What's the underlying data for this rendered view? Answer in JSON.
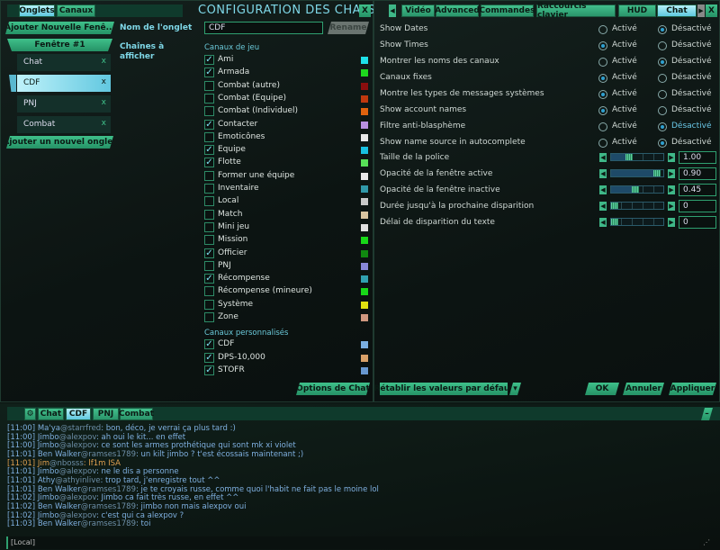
{
  "left": {
    "tabs": [
      "Onglets",
      "Canaux"
    ],
    "title": "CONFIGURATION DES CHATS",
    "close": "X",
    "add_window": "Ajouter Nouvelle Fenê...",
    "window_label": "Fenêtre #1",
    "chat_tabs": [
      {
        "label": "Chat",
        "selected": false
      },
      {
        "label": "CDF",
        "selected": true
      },
      {
        "label": "PNJ",
        "selected": false
      },
      {
        "label": "Combat",
        "selected": false
      }
    ],
    "remove_glyph": "x",
    "add_tab": "Ajouter un nouvel onglet",
    "tab_name_label": "Nom de l'onglet",
    "tab_name_value": "CDF",
    "rename": "Rename",
    "channels_label": "Chaînes à afficher",
    "game_channels_header": "Canaux de jeu",
    "game_channels": [
      {
        "label": "Ami",
        "checked": true,
        "color": "#1ee0e8"
      },
      {
        "label": "Armada",
        "checked": true,
        "color": "#1ed81e"
      },
      {
        "label": "Combat (autre)",
        "checked": false,
        "color": "#8a0e0e"
      },
      {
        "label": "Combat (Equipe)",
        "checked": false,
        "color": "#c0380e"
      },
      {
        "label": "Combat (Individuel)",
        "checked": false,
        "color": "#e0620e"
      },
      {
        "label": "Contacter",
        "checked": true,
        "color": "#b890e0"
      },
      {
        "label": "Emoticônes",
        "checked": false,
        "color": "#e8e8e8"
      },
      {
        "label": "Equipe",
        "checked": true,
        "color": "#18c0e0"
      },
      {
        "label": "Flotte",
        "checked": true,
        "color": "#58e058"
      },
      {
        "label": "Former une équipe",
        "checked": false,
        "color": "#e8e8e8"
      },
      {
        "label": "Inventaire",
        "checked": false,
        "color": "#3098a8"
      },
      {
        "label": "Local",
        "checked": false,
        "color": "#c8c8c8"
      },
      {
        "label": "Match",
        "checked": false,
        "color": "#d8c4a0"
      },
      {
        "label": "Mini jeu",
        "checked": false,
        "color": "#e0e0e0"
      },
      {
        "label": "Mission",
        "checked": false,
        "color": "#18d818"
      },
      {
        "label": "Officier",
        "checked": true,
        "color": "#108810"
      },
      {
        "label": "PNJ",
        "checked": false,
        "color": "#8888d8"
      },
      {
        "label": "Récompense",
        "checked": true,
        "color": "#30a0b0"
      },
      {
        "label": "Récompense (mineure)",
        "checked": false,
        "color": "#18d818"
      },
      {
        "label": "Système",
        "checked": false,
        "color": "#e0e010"
      },
      {
        "label": "Zone",
        "checked": false,
        "color": "#d09880"
      }
    ],
    "custom_channels_header": "Canaux personnalisés",
    "custom_channels": [
      {
        "label": "CDF",
        "checked": true,
        "color": "#7aaee0"
      },
      {
        "label": "DPS-10,000",
        "checked": true,
        "color": "#d8a068"
      },
      {
        "label": "STOFR",
        "checked": true,
        "color": "#6898d0"
      }
    ],
    "chat_options": "Options de Chat"
  },
  "right": {
    "tabs": [
      {
        "label": "Vidéo",
        "selected": false
      },
      {
        "label": "Advanced",
        "selected": false
      },
      {
        "label": "Commandes",
        "selected": false
      },
      {
        "label": "Raccourcis clavier",
        "selected": false
      },
      {
        "label": "HUD",
        "selected": false
      },
      {
        "label": "Chat",
        "selected": true
      }
    ],
    "close": "X",
    "on_label": "Activé",
    "off_label": "Désactivé",
    "toggles": [
      {
        "label": "Show Dates",
        "value": "off"
      },
      {
        "label": "Show Times",
        "value": "on"
      },
      {
        "label": "Montrer les noms des canaux",
        "value": "off"
      },
      {
        "label": "Canaux fixes",
        "value": "on"
      },
      {
        "label": "Montre les types de messages systèmes",
        "value": "on"
      },
      {
        "label": "Show account names",
        "value": "on"
      },
      {
        "label": "Filtre anti-blasphème",
        "value": "off"
      },
      {
        "label": "Show name source in autocomplete",
        "value": "off"
      }
    ],
    "sliders": [
      {
        "label": "Taille de la police",
        "value": "1.00",
        "level": 0.3
      },
      {
        "label": "Opacité de la fenêtre active",
        "value": "0.90",
        "level": 0.9
      },
      {
        "label": "Opacité de la fenêtre inactive",
        "value": "0.45",
        "level": 0.45
      },
      {
        "label": "Durée jusqu'à la prochaine disparition",
        "value": "0",
        "level": 0
      },
      {
        "label": "Délai de disparition du texte",
        "value": "0",
        "level": 0
      }
    ],
    "reset": "Rétablir les valeurs par défaut",
    "ok": "OK",
    "cancel": "Annuler",
    "apply": "Appliquer"
  },
  "chat": {
    "tabs": [
      {
        "label": "Chat",
        "selected": false
      },
      {
        "label": "CDF",
        "selected": true
      },
      {
        "label": "PNJ",
        "selected": false
      },
      {
        "label": "Combat",
        "selected": false
      }
    ],
    "minimize": "–",
    "messages": [
      {
        "time": "[11:00]",
        "name": "Ma'ya",
        "account": "@starrfred",
        "text": ": bon, déco, je verrai ça plus tard :)"
      },
      {
        "time": "[11:00]",
        "name": "Jimbo",
        "account": "@alexpov",
        "text": ": ah oui le kit... en effet"
      },
      {
        "time": "[11:00]",
        "name": "Jimbo",
        "account": "@alexpov",
        "text": ": ce sont les armes prothétique qui sont mk xi violet"
      },
      {
        "time": "[11:01]",
        "name": "Ben Walker",
        "account": "@ramses1789",
        "text": ": un kilt jimbo ? t'est écossais maintenant ;)"
      },
      {
        "time": "[11:01]",
        "name": "Jim",
        "account": "@nbosss",
        "text": ": lf1m ISA",
        "color": "#e0a050"
      },
      {
        "time": "[11:01]",
        "name": "Jimbo",
        "account": "@alexpov",
        "text": ": ne le dis a personne"
      },
      {
        "time": "[11:01]",
        "name": "Athy",
        "account": "@athyinlive",
        "text": ": trop tard, j'enregistre tout ^^"
      },
      {
        "time": "[11:01]",
        "name": "Ben Walker",
        "account": "@ramses1789",
        "text": ": je te croyais russe, comme quoi l'habit ne fait pas le moine lol"
      },
      {
        "time": "[11:02]",
        "name": "Jimbo",
        "account": "@alexpov",
        "text": ": Jimbo ca fait très russe, en effet ^^"
      },
      {
        "time": "[11:02]",
        "name": "Ben Walker",
        "account": "@ramses1789",
        "text": ": jimbo non mais alexpov oui"
      },
      {
        "time": "[11:02]",
        "name": "Jimbo",
        "account": "@alexpov",
        "text": ": c'est qui ca alexpov ?"
      },
      {
        "time": "[11:03]",
        "name": "Ben Walker",
        "account": "@ramses1789",
        "text": ": toi"
      }
    ],
    "input_value": "[Local]"
  }
}
